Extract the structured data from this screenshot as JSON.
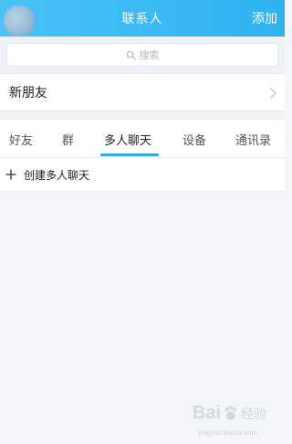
{
  "header": {
    "title": "联系人",
    "add_label": "添加"
  },
  "search": {
    "placeholder": "搜索"
  },
  "new_friends": {
    "label": "新朋友"
  },
  "tabs": [
    {
      "label": "好友"
    },
    {
      "label": "群"
    },
    {
      "label": "多人聊天",
      "active": true
    },
    {
      "label": "设备"
    },
    {
      "label": "通讯录"
    }
  ],
  "create_group": {
    "label": "创建多人聊天"
  },
  "watermark": {
    "brand": "Bai",
    "brand_suffix": "经验",
    "domain": "jingyan.baidu.com"
  },
  "colors": {
    "header": "#3bb8f4",
    "tab_active_underline": "#31a9e6"
  }
}
